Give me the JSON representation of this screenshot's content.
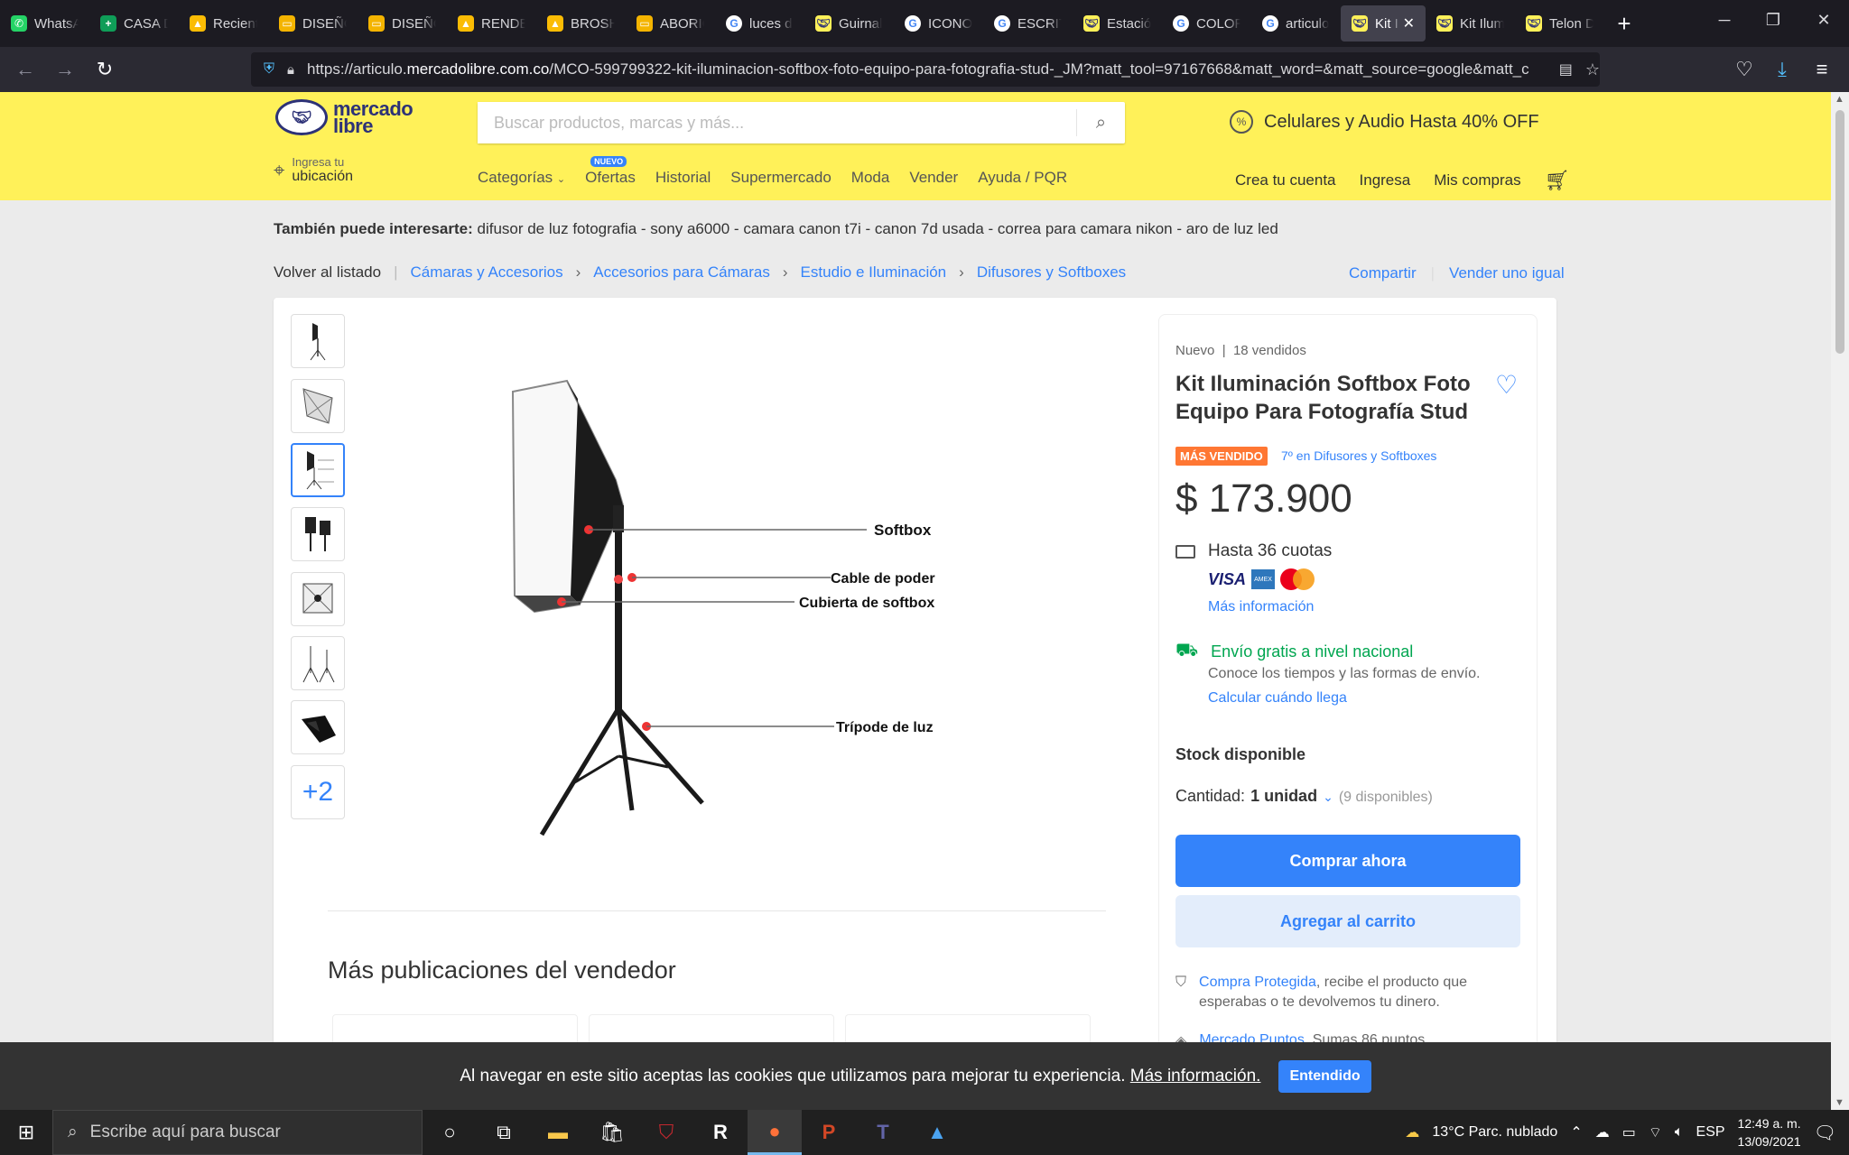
{
  "browser": {
    "tabs": [
      {
        "label": "WhatsA",
        "icon": "whatsapp-icon",
        "color": "#25d366"
      },
      {
        "label": "CASA D",
        "icon": "sheets-icon",
        "color": "#0f9d58"
      },
      {
        "label": "Recient",
        "icon": "drive-icon",
        "color": "#fbbc04"
      },
      {
        "label": "DISEÑO",
        "icon": "slides-icon",
        "color": "#f4b400"
      },
      {
        "label": "DISEÑO",
        "icon": "slides-icon",
        "color": "#f4b400"
      },
      {
        "label": "RENDE",
        "icon": "drive-icon",
        "color": "#fbbc04"
      },
      {
        "label": "BROSH",
        "icon": "drive-icon",
        "color": "#fbbc04"
      },
      {
        "label": "ABORIC",
        "icon": "slides-icon",
        "color": "#f4b400"
      },
      {
        "label": "luces d",
        "icon": "google-icon",
        "color": "#ffffff"
      },
      {
        "label": "Guirnal",
        "icon": "mercadolibre-icon",
        "color": "#fff159"
      },
      {
        "label": "ICONO",
        "icon": "google-icon",
        "color": "#ffffff"
      },
      {
        "label": "ESCRITO",
        "icon": "google-icon",
        "color": "#ffffff"
      },
      {
        "label": "Estación",
        "icon": "mercadolibre-icon",
        "color": "#fff159"
      },
      {
        "label": "COLOR",
        "icon": "google-icon",
        "color": "#ffffff"
      },
      {
        "label": "articulo",
        "icon": "google-icon",
        "color": "#ffffff"
      },
      {
        "label": "Kit Ili",
        "icon": "mercadolibre-icon",
        "color": "#fff159",
        "active": true
      },
      {
        "label": "Kit Ilum",
        "icon": "mercadolibre-icon",
        "color": "#fff159"
      },
      {
        "label": "Telon D",
        "icon": "mercadolibre-icon",
        "color": "#fff159"
      }
    ],
    "url_prefix": "https://articulo.",
    "url_domain": "mercadolibre.com.co",
    "url_rest": "/MCO-599799322-kit-iluminacion-softbox-foto-equipo-para-fotografia-stud-_JM?matt_tool=97167668&matt_word=&matt_source=google&matt_c"
  },
  "header": {
    "logo_line1": "mercado",
    "logo_line2": "libre",
    "search_placeholder": "Buscar productos, marcas y más...",
    "promo": "Celulares y Audio Hasta 40% OFF",
    "location_line1": "Ingresa tu",
    "location_line2": "ubicación",
    "nav": [
      "Categorías",
      "Ofertas",
      "Historial",
      "Supermercado",
      "Moda",
      "Vender",
      "Ayuda / PQR"
    ],
    "nuevo_badge": "NUEVO",
    "user_nav": [
      "Crea tu cuenta",
      "Ingresa",
      "Mis compras"
    ]
  },
  "related": {
    "label": "También puede interesarte:",
    "items": "difusor de luz fotografia - sony a6000 - camara canon t7i - canon 7d usada - correa para camara nikon - aro de luz led"
  },
  "breadcrumb": {
    "back": "Volver al listado",
    "items": [
      "Cámaras y Accesorios",
      "Accesorios para Cámaras",
      "Estudio e Iluminación",
      "Difusores y Softboxes"
    ],
    "share": "Compartir",
    "sell_same": "Vender uno igual"
  },
  "gallery": {
    "more_label": "+2",
    "labels": [
      "Softbox",
      "Cable de poder",
      "Cubierta de softbox",
      "Trípode de luz"
    ]
  },
  "seller": {
    "title": "Más publicaciones del vendedor"
  },
  "product": {
    "condition": "Nuevo",
    "sold": "18 vendidos",
    "title": "Kit Iluminación Softbox Foto Equipo Para Fotografía Stud",
    "badge": "MÁS VENDIDO",
    "rank": "7º en Difusores y Softboxes",
    "price": "$ 173.900",
    "installments": "Hasta 36 cuotas",
    "more_info": "Más información",
    "shipping": "Envío gratis a nivel nacional",
    "shipping_sub": "Conoce los tiempos y las formas de envío.",
    "calc": "Calcular cuándo llega",
    "stock": "Stock disponible",
    "qty_label": "Cantidad:",
    "qty_value": "1 unidad",
    "qty_available": "(9 disponibles)",
    "buy_now": "Comprar ahora",
    "add_cart": "Agregar al carrito",
    "protect_link": "Compra Protegida",
    "protect_text": ", recibe el producto que esperabas o te devolvemos tu dinero.",
    "points_link": "Mercado Puntos",
    "points_text": ". Sumas 86 puntos."
  },
  "cookie": {
    "text": "Al navegar en este sitio aceptas las cookies que utilizamos para mejorar tu experiencia.",
    "link": "Más información.",
    "button": "Entendido"
  },
  "taskbar": {
    "search_placeholder": "Escribe aquí para buscar",
    "weather": "13°C  Parc. nublado",
    "lang": "ESP",
    "time": "12:49 a. m.",
    "date": "13/09/2021"
  }
}
